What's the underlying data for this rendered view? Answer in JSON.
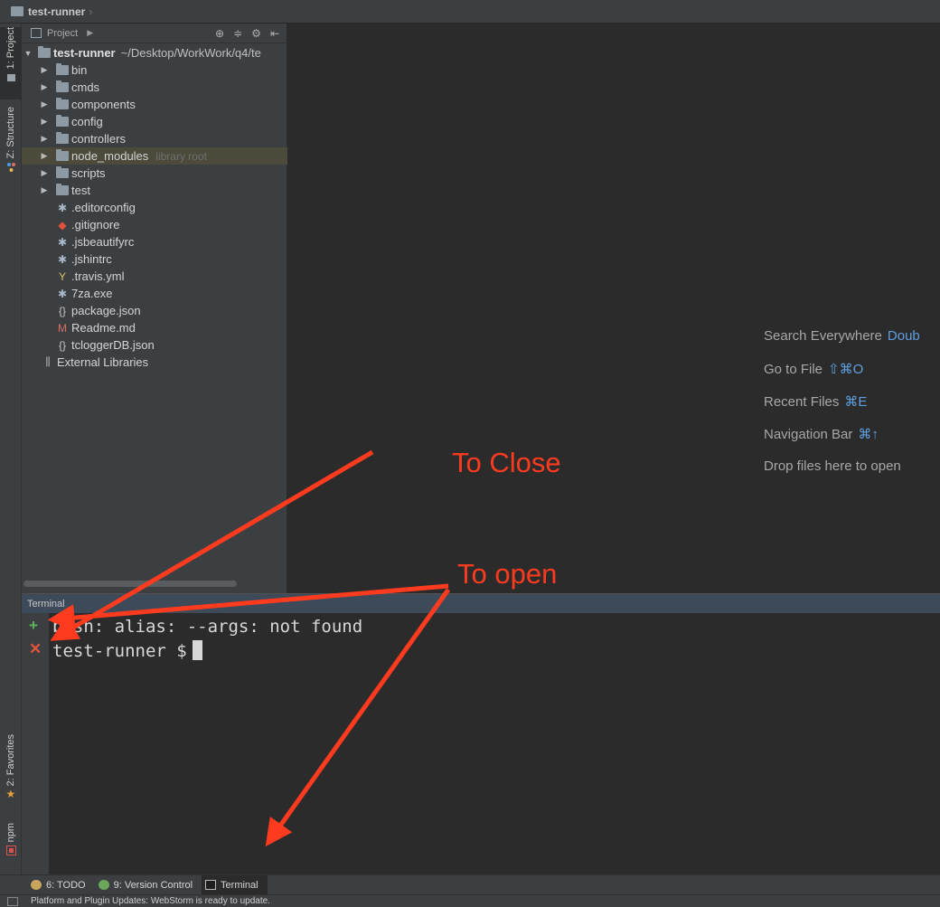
{
  "navbar": {
    "title": "test-runner"
  },
  "left_strip": {
    "tabs": [
      {
        "label": "1: Project"
      },
      {
        "label": "Z: Structure"
      },
      {
        "label": "2: Favorites"
      },
      {
        "label": "npm"
      }
    ]
  },
  "project_panel": {
    "header": "Project",
    "root": {
      "name": "test-runner",
      "path": "~/Desktop/WorkWork/q4/te"
    },
    "items": [
      {
        "name": "bin",
        "type": "folder",
        "expandable": true
      },
      {
        "name": "cmds",
        "type": "folder",
        "expandable": true
      },
      {
        "name": "components",
        "type": "folder",
        "expandable": true
      },
      {
        "name": "config",
        "type": "folder",
        "expandable": true
      },
      {
        "name": "controllers",
        "type": "folder",
        "expandable": true
      },
      {
        "name": "node_modules",
        "type": "folder",
        "expandable": true,
        "hint": "library root",
        "selected": true
      },
      {
        "name": "scripts",
        "type": "folder",
        "expandable": true
      },
      {
        "name": "test",
        "type": "folder",
        "expandable": true
      },
      {
        "name": ".editorconfig",
        "type": "asterisk-file"
      },
      {
        "name": ".gitignore",
        "type": "git-file"
      },
      {
        "name": ".jsbeautifyrc",
        "type": "asterisk-file"
      },
      {
        "name": ".jshintrc",
        "type": "asterisk-file"
      },
      {
        "name": ".travis.yml",
        "type": "yaml-file"
      },
      {
        "name": "7za.exe",
        "type": "asterisk-file"
      },
      {
        "name": "package.json",
        "type": "json-file"
      },
      {
        "name": "Readme.md",
        "type": "markdown-file"
      },
      {
        "name": "tcloggerDB.json",
        "type": "json-file"
      },
      {
        "name": "External Libraries",
        "type": "libraries"
      }
    ]
  },
  "editor": {
    "hints": [
      {
        "label": "Search Everywhere",
        "key": "Doub"
      },
      {
        "label": "Go to File",
        "key": "⇧⌘O"
      },
      {
        "label": "Recent Files",
        "key": "⌘E"
      },
      {
        "label": "Navigation Bar",
        "key": "⌘↑"
      },
      {
        "label": "Drop files here to open",
        "key": ""
      }
    ]
  },
  "terminal": {
    "title": "Terminal",
    "lines": [
      "bash: alias: --args: not found",
      "test-runner $"
    ],
    "new_symbol": "+",
    "close_symbol": "✕"
  },
  "bottom_bar": {
    "tabs": [
      {
        "label": "6: TODO"
      },
      {
        "label": "9: Version Control"
      },
      {
        "label": "Terminal",
        "active": true
      }
    ]
  },
  "status_bar": {
    "text": "Platform and Plugin Updates: WebStorm is ready to update."
  },
  "annotations": {
    "close_label": "To Close",
    "open_label": "To open"
  },
  "colors": {
    "accent": "#ff3b1f",
    "key_blue": "#5f9ee0",
    "terminal_green": "#5fb35f",
    "terminal_red": "#e0533d"
  }
}
